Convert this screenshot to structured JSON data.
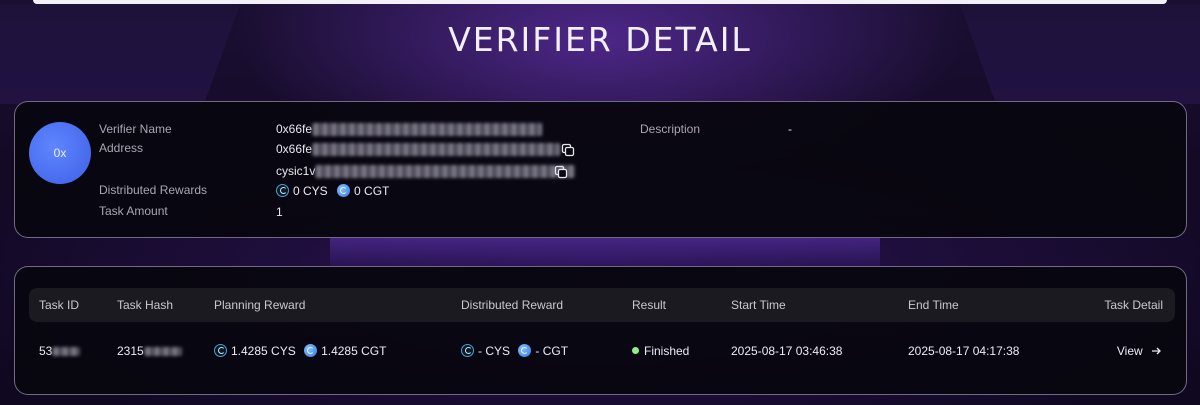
{
  "page": {
    "title": "VERIFIER DETAIL"
  },
  "verifier": {
    "avatar_text": "0x",
    "labels": {
      "name": "Verifier Name",
      "address": "Address",
      "rewards": "Distributed Rewards",
      "task_amount": "Task Amount",
      "description": "Description"
    },
    "name_prefix": "0x66fe",
    "address_prefix": "0x66fe",
    "address2_prefix": "cysic1v",
    "distributed_rewards": {
      "cys": "0 CYS",
      "cgt": "0 CGT"
    },
    "task_amount": "1",
    "description": "-"
  },
  "tasks": {
    "columns": [
      "Task ID",
      "Task Hash",
      "Planning Reward",
      "Distributed Reward",
      "Result",
      "Start Time",
      "End Time",
      "Task Detail"
    ],
    "rows": [
      {
        "task_id": "53",
        "task_hash": "2315",
        "planning_cys": "1.4285 CYS",
        "planning_cgt": "1.4285 CGT",
        "dist_cys": "- CYS",
        "dist_cgt": "- CGT",
        "result": "Finished",
        "start_time": "2025-08-17 03:46:38",
        "end_time": "2025-08-17 04:17:38",
        "detail_label": "View"
      }
    ]
  },
  "colors": {
    "accent": "#4f74f5",
    "finished": "#8ff08a"
  },
  "icons": [
    "copy-icon",
    "cys-coin-icon",
    "cgt-coin-icon",
    "arrow-right-icon"
  ]
}
